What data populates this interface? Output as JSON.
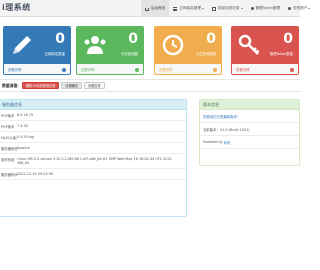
{
  "app": {
    "title": "i理系统"
  },
  "nav": [
    {
      "label": "后台首页",
      "icon": "home-icon",
      "active": true
    },
    {
      "label": "正网域名管理",
      "icon": "list-icon",
      "active": false
    },
    {
      "label": "绑定检测记录",
      "icon": "calendar-icon",
      "active": false
    },
    {
      "label": "管理Token管理",
      "icon": "user-icon",
      "active": false
    },
    {
      "label": "您的账户",
      "icon": "user-icon",
      "active": false
    }
  ],
  "cards": [
    {
      "value": "0",
      "label": "正网绑定数量",
      "link": "查看详情",
      "icon": "pencil-icon",
      "color": "#337ab7"
    },
    {
      "value": "0",
      "label": "今日检测数",
      "link": "查看详情",
      "icon": "users-icon",
      "color": "#5cb85c"
    },
    {
      "value": "0",
      "label": "今日查询数量",
      "link": "查看详情",
      "icon": "clock-icon",
      "color": "#f0ad4e"
    },
    {
      "value": "0",
      "label": "管理Token数量",
      "link": "查看详情",
      "icon": "key-icon",
      "color": "#d9534f"
    }
  ],
  "actions": {
    "label": "数据清理:",
    "buttons": [
      "删除15天前检测记录",
      "清理缓存",
      "清理文件"
    ]
  },
  "system_info": {
    "title": "服务器信息",
    "rows": [
      {
        "key": "PHP版本",
        "value": "8.0.18,75"
      },
      {
        "key": "PHP版本",
        "value": "7.4.30"
      },
      {
        "key": "MySQL版本",
        "value": "5.5.55-log"
      },
      {
        "key": "服务器软件",
        "value": "Apache"
      },
      {
        "key": "操作系统",
        "value": "Linux VM-0-3-centos 3.10.0-1160.66.1.el7.x86_64 #1 SMP Wed May 18 16:02:34 UTC 2022 x86_64"
      },
      {
        "key": "服务器时间",
        "value": "2022-11-10 09:23:56"
      }
    ]
  },
  "version_info": {
    "title": "版本信息",
    "latest": "您使用的已是最新版本！",
    "current": "当前版本：V1.0 (Build 1001)",
    "powered_prefix": "Powered by",
    "powered_link": "彩虹"
  }
}
